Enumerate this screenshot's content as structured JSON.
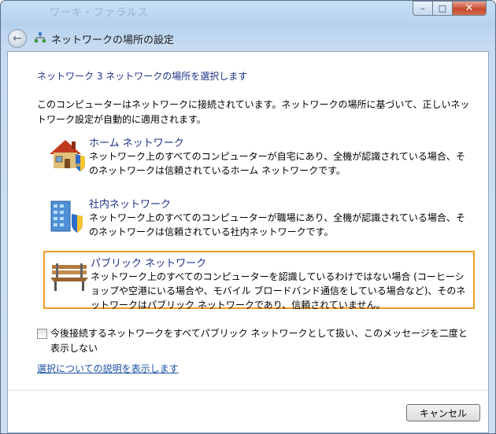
{
  "titlebar": {
    "ghost_title": "ワーキ・ファラルス",
    "minimize_label": "–",
    "maximize_label": "□",
    "close_label": "✕"
  },
  "navbar": {
    "back_glyph": "←",
    "title": "ネットワークの場所の設定"
  },
  "main": {
    "heading": "ネットワーク 3 ネットワークの場所を選択します",
    "description": "このコンピューターはネットワークに接続されています。ネットワークの場所に基づいて、正しいネットワーク設定が自動的に適用されます。"
  },
  "options": [
    {
      "title": "ホーム ネットワーク",
      "description": "ネットワーク上のすべてのコンピューターが自宅にあり、全機が認識されている場合、そのネットワークは信頼されているホーム ネットワークです。",
      "icon": "house-shield-icon"
    },
    {
      "title": "社内ネットワーク",
      "description": "ネットワーク上のすべてのコンピューターが職場にあり、全機が認識されている場合、そのネットワークは信頼されている社内ネットワークです。",
      "icon": "office-building-shield-icon"
    },
    {
      "title": "パブリック ネットワーク",
      "description": "ネットワーク上のすべてのコンピューターを認識しているわけではない場合 (コーヒーショップや空港にいる場合や、モバイル ブロードバンド通信をしている場合など)、そのネットワークはパブリック ネットワークであり、信頼されていません。",
      "icon": "park-bench-icon"
    }
  ],
  "checkbox": {
    "checked": false,
    "label": "今後接続するネットワークをすべてパブリック ネットワークとして扱い、このメッセージを二度と表示しない"
  },
  "help_link": "選択についての説明を表示します",
  "buttons": {
    "cancel": "キャンセル"
  },
  "colors": {
    "accent_text": "#1e3287",
    "link": "#1a4fa3",
    "highlight_border": "#f39a28"
  }
}
